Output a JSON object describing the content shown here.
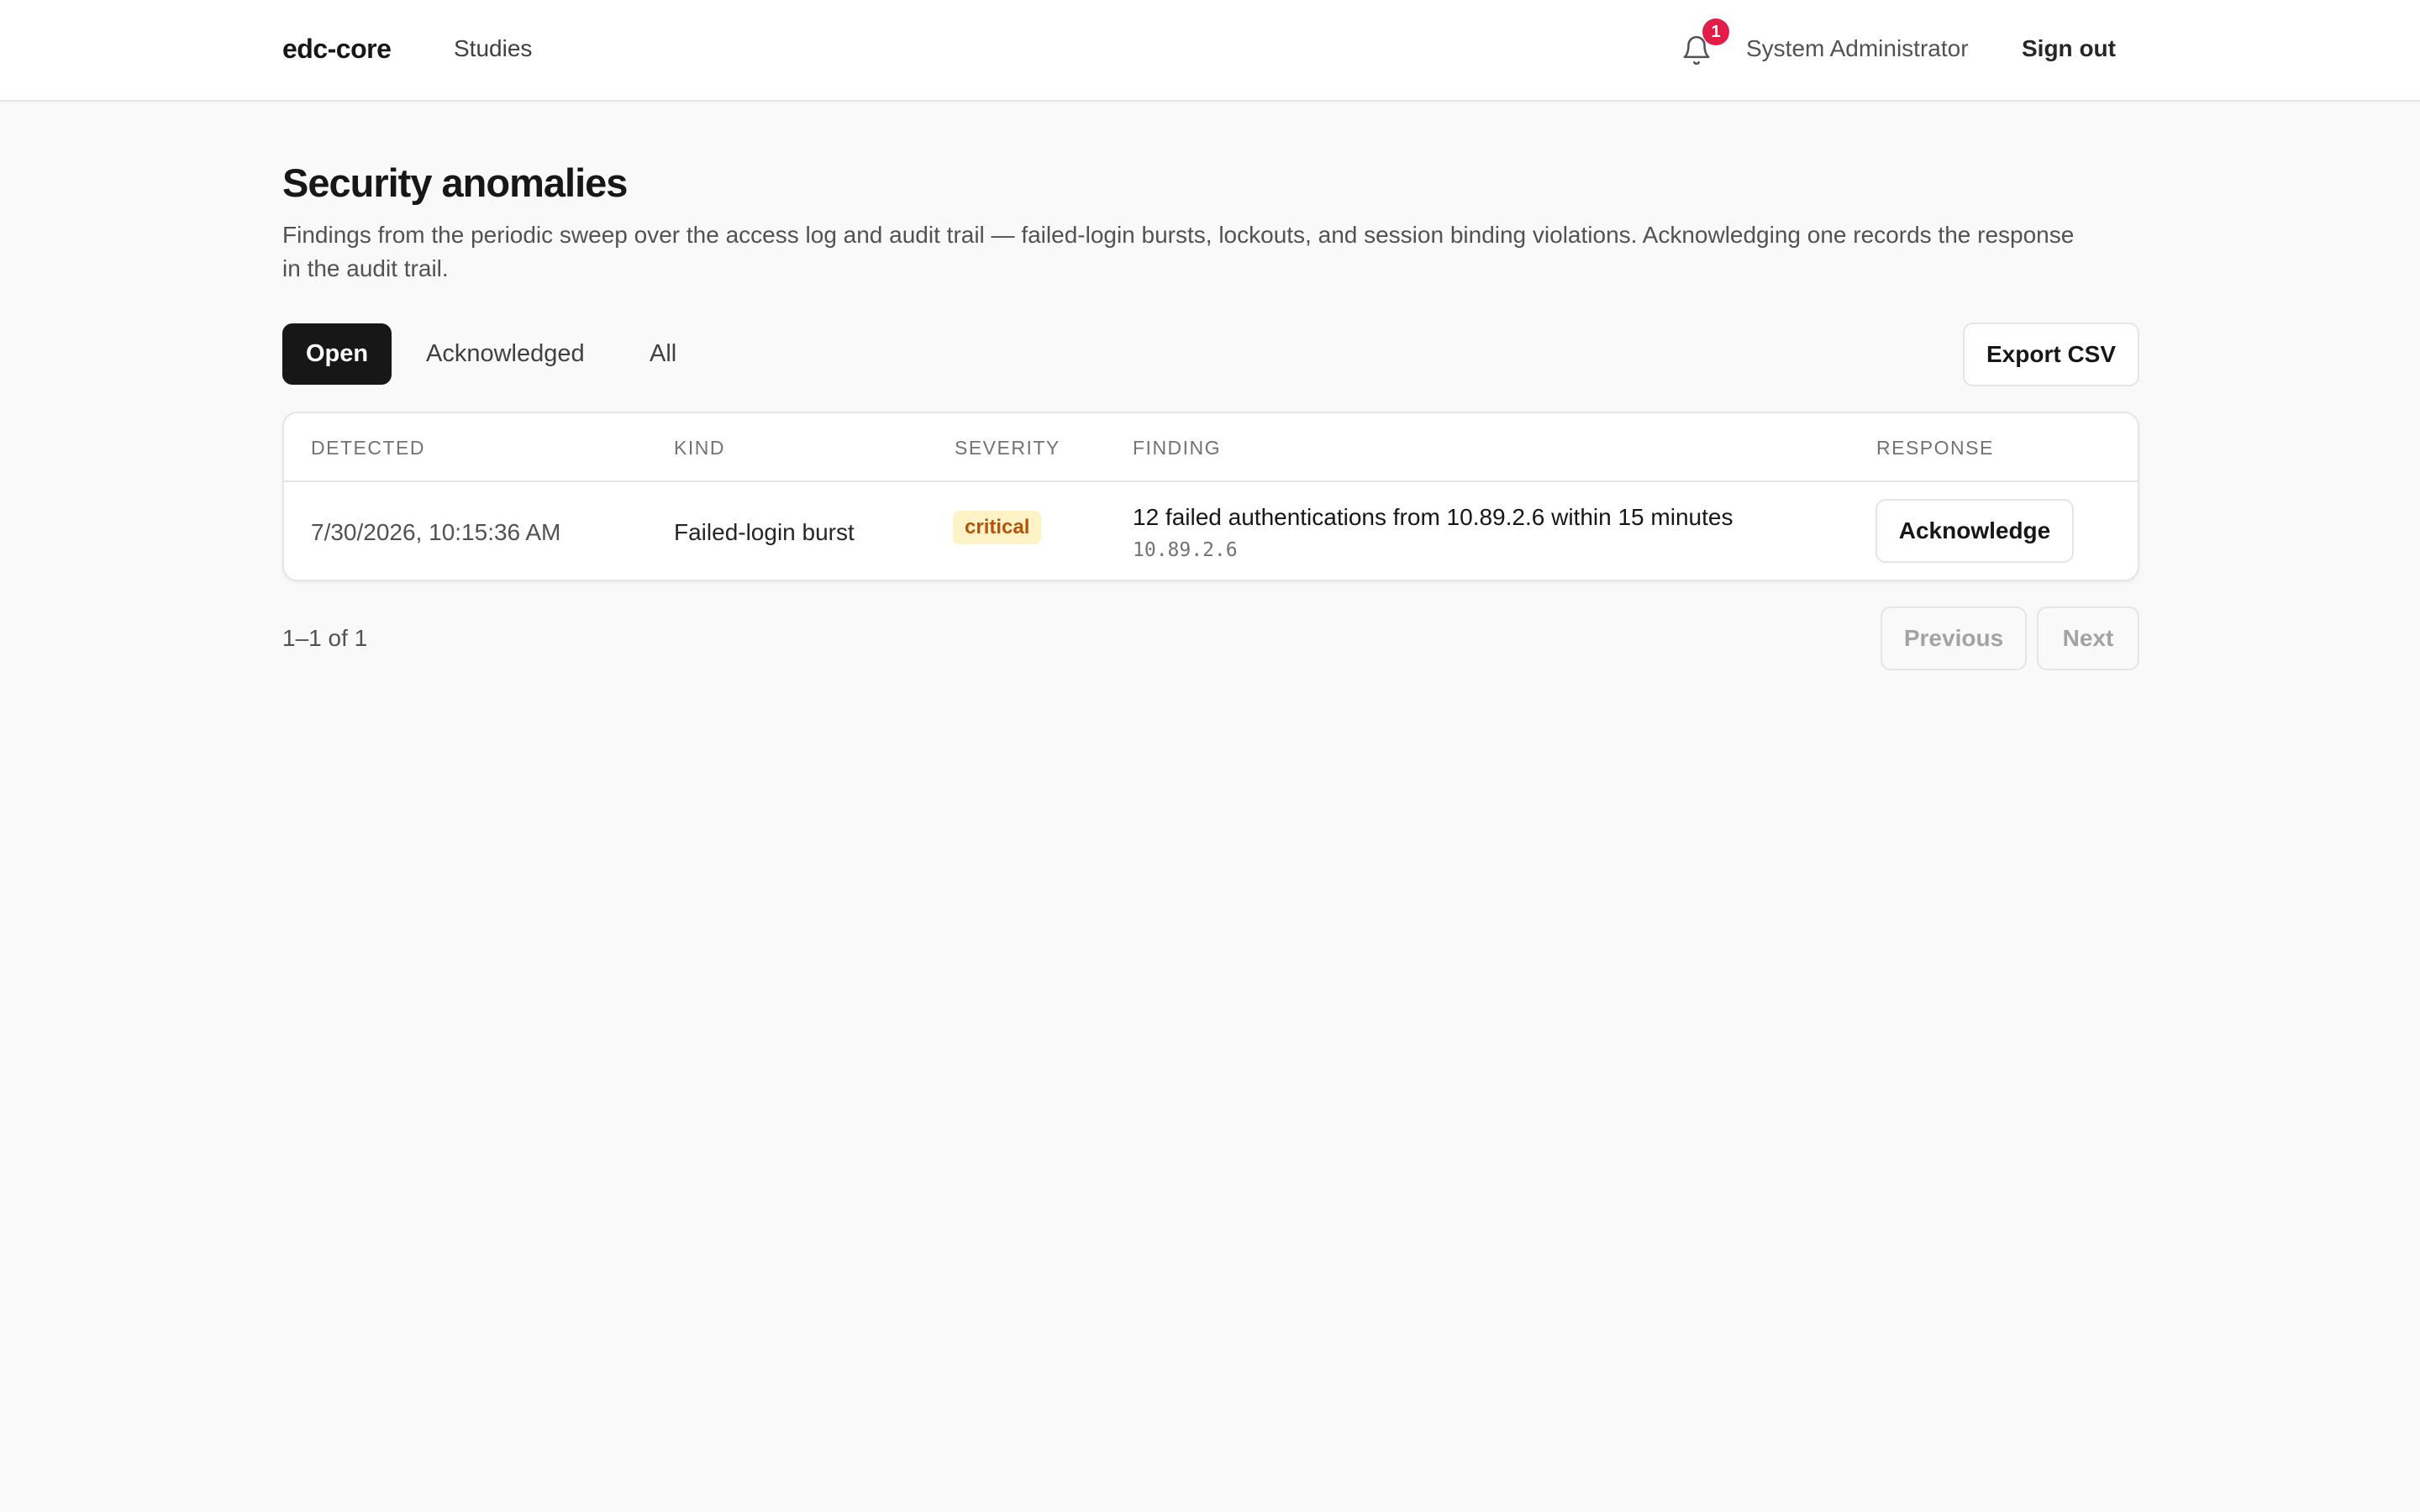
{
  "app": {
    "brand": "edc-core",
    "nav": {
      "studies": "Studies"
    },
    "notifications": {
      "icon": "bell-icon",
      "count": "1"
    },
    "user_name": "System Administrator",
    "sign_out": "Sign out"
  },
  "page": {
    "title": "Security anomalies",
    "description": "Findings from the periodic sweep over the access log and audit trail — failed-login bursts, lockouts, and session binding violations. Acknowledging one records the response in the audit trail."
  },
  "filters": {
    "tabs": [
      {
        "label": "Open",
        "active": true
      },
      {
        "label": "Acknowledged",
        "active": false
      },
      {
        "label": "All",
        "active": false
      }
    ],
    "export_label": "Export CSV"
  },
  "table": {
    "columns": [
      "DETECTED",
      "KIND",
      "SEVERITY",
      "FINDING",
      "RESPONSE"
    ],
    "rows": [
      {
        "detected": "7/30/2026, 10:15:36 AM",
        "kind": "Failed-login burst",
        "severity": "critical",
        "finding": "12 failed authentications from 10.89.2.6 within 15 minutes",
        "finding_detail": "10.89.2.6",
        "action": "Acknowledge"
      }
    ]
  },
  "pagination": {
    "range": "1–1 of 1",
    "previous": "Previous",
    "next": "Next"
  },
  "colors": {
    "accent": "#171717",
    "notification_badge": "#e11d48",
    "severity_critical_bg": "#fef3c7",
    "severity_critical_text": "#b45309"
  }
}
